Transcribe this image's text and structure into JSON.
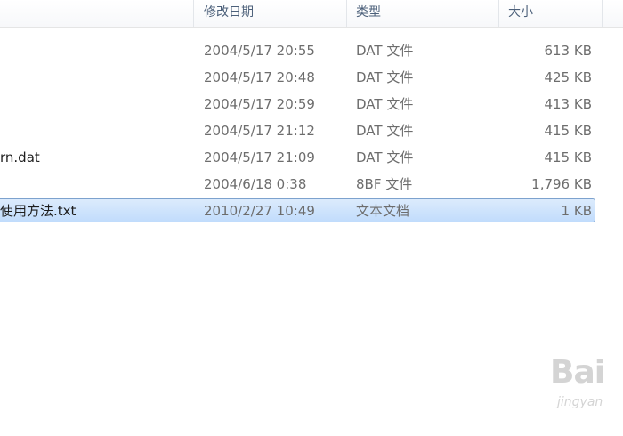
{
  "columns": {
    "date_modified": "修改日期",
    "type": "类型",
    "size": "大小"
  },
  "files": [
    {
      "name": "",
      "date": "2004/5/17 20:55",
      "type": "DAT 文件",
      "size": "613 KB",
      "selected": false
    },
    {
      "name": "",
      "date": "2004/5/17 20:48",
      "type": "DAT 文件",
      "size": "425 KB",
      "selected": false
    },
    {
      "name": "",
      "date": "2004/5/17 20:59",
      "type": "DAT 文件",
      "size": "413 KB",
      "selected": false
    },
    {
      "name": "",
      "date": "2004/5/17 21:12",
      "type": "DAT 文件",
      "size": "415 KB",
      "selected": false
    },
    {
      "name": "rn.dat",
      "date": "2004/5/17 21:09",
      "type": "DAT 文件",
      "size": "415 KB",
      "selected": false
    },
    {
      "name": "",
      "date": "2004/6/18 0:38",
      "type": "8BF 文件",
      "size": "1,796 KB",
      "selected": false
    },
    {
      "name": "使用方法.txt",
      "date": "2010/2/27 10:49",
      "type": "文本文档",
      "size": "1 KB",
      "selected": true
    }
  ],
  "watermark": {
    "main": "Bai",
    "sub": "jingyan"
  },
  "colors": {
    "selection": "#cde4fc",
    "selection_border": "#7da2ce",
    "header_text": "#4c607a"
  }
}
